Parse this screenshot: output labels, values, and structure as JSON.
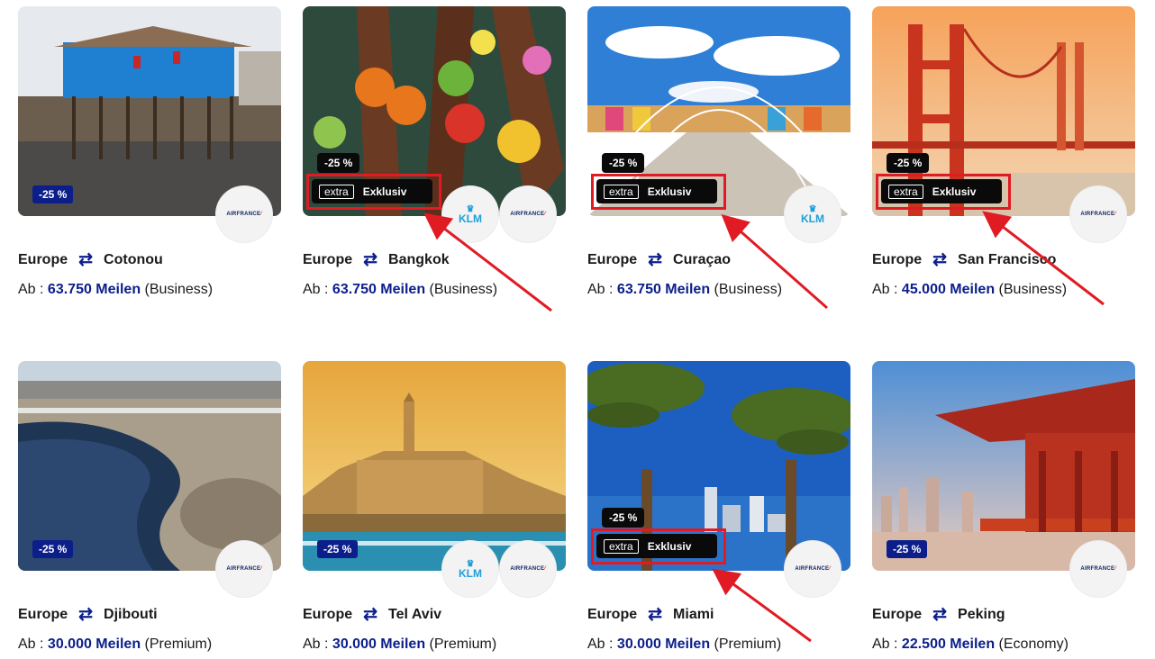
{
  "cards": [
    {
      "origin": "Europe",
      "destination": "Cotonou",
      "prefix": "Ab :",
      "miles": "63.750 Meilen",
      "cabin": "(Business)",
      "discount": "-25 %",
      "airlines": [
        "AIRFRANCE"
      ]
    },
    {
      "origin": "Europe",
      "destination": "Bangkok",
      "prefix": "Ab :",
      "miles": "63.750 Meilen",
      "cabin": "(Business)",
      "discount": "-25 %",
      "extra": "extra",
      "exclusive": "Exklusiv",
      "airlines": [
        "KLM",
        "AIRFRANCE"
      ]
    },
    {
      "origin": "Europe",
      "destination": "Curaçao",
      "prefix": "Ab :",
      "miles": "63.750 Meilen",
      "cabin": "(Business)",
      "discount": "-25 %",
      "extra": "extra",
      "exclusive": "Exklusiv",
      "airlines": [
        "KLM"
      ]
    },
    {
      "origin": "Europe",
      "destination": "San Francisco",
      "prefix": "Ab :",
      "miles": "45.000 Meilen",
      "cabin": "(Business)",
      "discount": "-25 %",
      "extra": "extra",
      "exclusive": "Exklusiv",
      "airlines": [
        "AIRFRANCE"
      ]
    },
    {
      "origin": "Europe",
      "destination": "Djibouti",
      "prefix": "Ab :",
      "miles": "30.000 Meilen",
      "cabin": "(Premium)",
      "discount": "-25 %",
      "airlines": [
        "AIRFRANCE"
      ]
    },
    {
      "origin": "Europe",
      "destination": "Tel Aviv",
      "prefix": "Ab :",
      "miles": "30.000 Meilen",
      "cabin": "(Premium)",
      "discount": "-25 %",
      "airlines": [
        "KLM",
        "AIRFRANCE"
      ]
    },
    {
      "origin": "Europe",
      "destination": "Miami",
      "prefix": "Ab :",
      "miles": "30.000 Meilen",
      "cabin": "(Premium)",
      "discount": "-25 %",
      "extra": "extra",
      "exclusive": "Exklusiv",
      "airlines": [
        "AIRFRANCE"
      ]
    },
    {
      "origin": "Europe",
      "destination": "Peking",
      "prefix": "Ab :",
      "miles": "22.500 Meilen",
      "cabin": "(Economy)",
      "discount": "-25 %",
      "airlines": [
        "AIRFRANCE"
      ]
    }
  ],
  "logos": {
    "airfrance": "AIRFRANCE",
    "klm": "KLM"
  },
  "icons": {
    "route": "swap-arrows-icon",
    "klm_crown": "crown-icon"
  },
  "colors": {
    "accent": "#0b1e8a",
    "highlight_box": "#e01b24",
    "badge_dark": "#0a0a0a"
  }
}
